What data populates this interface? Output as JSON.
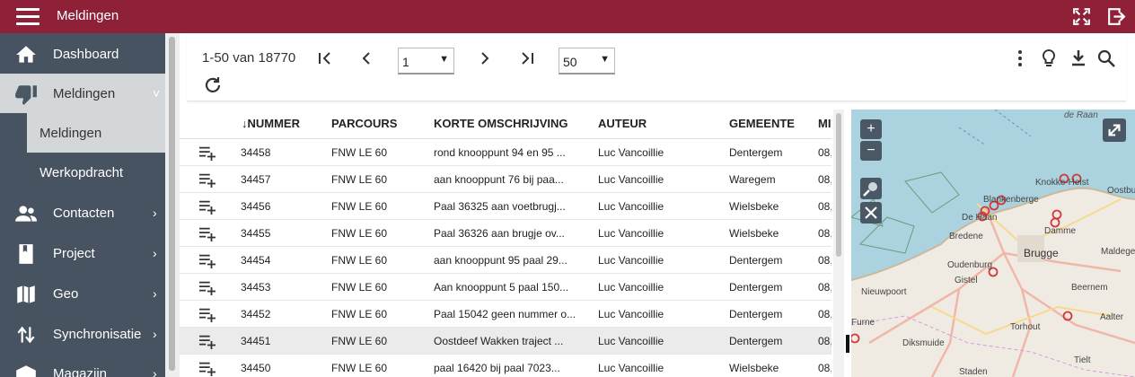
{
  "header": {
    "title": "Meldingen"
  },
  "sidebar": {
    "items": [
      {
        "label": "Dashboard"
      },
      {
        "label": "Meldingen",
        "chevron": "˅"
      },
      {
        "label": "Contacten",
        "chevron": "›"
      },
      {
        "label": "Project",
        "chevron": "›"
      },
      {
        "label": "Geo",
        "chevron": "›"
      },
      {
        "label": "Synchronisatie",
        "chevron": "›"
      },
      {
        "label": "Magazijn",
        "chevron": "›"
      }
    ],
    "subitems": [
      {
        "label": "Meldingen",
        "selected": true
      },
      {
        "label": "Werkopdracht",
        "selected": false
      }
    ]
  },
  "toolbar": {
    "count": "1-50 van 18770",
    "page_value": "1",
    "page_size_value": "50"
  },
  "table": {
    "columns": [
      "↓NUMMER",
      "PARCOURS",
      "KORTE OMSCHRIJVING",
      "AUTEUR",
      "GEMEENTE",
      "MI"
    ],
    "rows": [
      [
        "34458",
        "FNW LE 60",
        "rond knooppunt 94 en 95 ...",
        "Luc Vancoillie",
        "Dentergem",
        "08,"
      ],
      [
        "34457",
        "FNW LE 60",
        "aan knooppunt 76 bij paa...",
        "Luc Vancoillie",
        "Waregem",
        "08,"
      ],
      [
        "34456",
        "FNW LE 60",
        "Paal 36325 aan voetbrugj...",
        "Luc Vancoillie",
        "Wielsbeke",
        "08,"
      ],
      [
        "34455",
        "FNW LE 60",
        "Paal 36326 aan brugje ov...",
        "Luc Vancoillie",
        "Wielsbeke",
        "08,"
      ],
      [
        "34454",
        "FNW LE 60",
        "aan knooppunt 95 paal 29...",
        "Luc Vancoillie",
        "Dentergem",
        "08,"
      ],
      [
        "34453",
        "FNW LE 60",
        "Aan knooppunt 5 paal 150...",
        "Luc Vancoillie",
        "Dentergem",
        "08,"
      ],
      [
        "34452",
        "FNW LE 60",
        "Paal 15042 geen nummer o...",
        "Luc Vancoillie",
        "Dentergem",
        "08,"
      ],
      [
        "34451",
        "FNW LE 60",
        "Oostdeef Wakken traject ...",
        "Luc Vancoillie",
        "Dentergem",
        "08,"
      ],
      [
        "34450",
        "FNW LE 60",
        "paal 16420 bij paal 7023...",
        "Luc Vancoillie",
        "Wielsbeke",
        "08,"
      ]
    ]
  },
  "map": {
    "zoom_in": "+",
    "zoom_out": "−",
    "labels": [
      "de Raan",
      "Knokke-Heist",
      "Oostbu",
      "Blankenberge",
      "De Haan",
      "Damme",
      "Bredene",
      "Brugge",
      "Maldegem",
      "Oudenburg",
      "Gistel",
      "Nieuwpoort",
      "Beernem",
      "Furne",
      "Torhout",
      "Aalter",
      "Diksmuide",
      "Tielt",
      "Staden"
    ]
  },
  "colors": {
    "header_bg": "#8e2038",
    "sidebar_bg": "#475360",
    "active_bg": "#d4d7da",
    "sea": "#aad3df",
    "marker": "#d23a3a"
  },
  "icons": [
    "menu-icon",
    "fullscreen-icon",
    "logout-icon",
    "home-icon",
    "thumbs-down-icon",
    "contacts-icon",
    "book-icon",
    "map-icon",
    "sync-icon",
    "warehouse-icon",
    "first-page-icon",
    "previous-page-icon",
    "next-page-icon",
    "last-page-icon",
    "more-vert-icon",
    "lightbulb-icon",
    "download-icon",
    "search-icon",
    "refresh-icon",
    "playlist-add-icon",
    "fullscreen-map-icon",
    "magnifier-icon",
    "close-icon"
  ]
}
